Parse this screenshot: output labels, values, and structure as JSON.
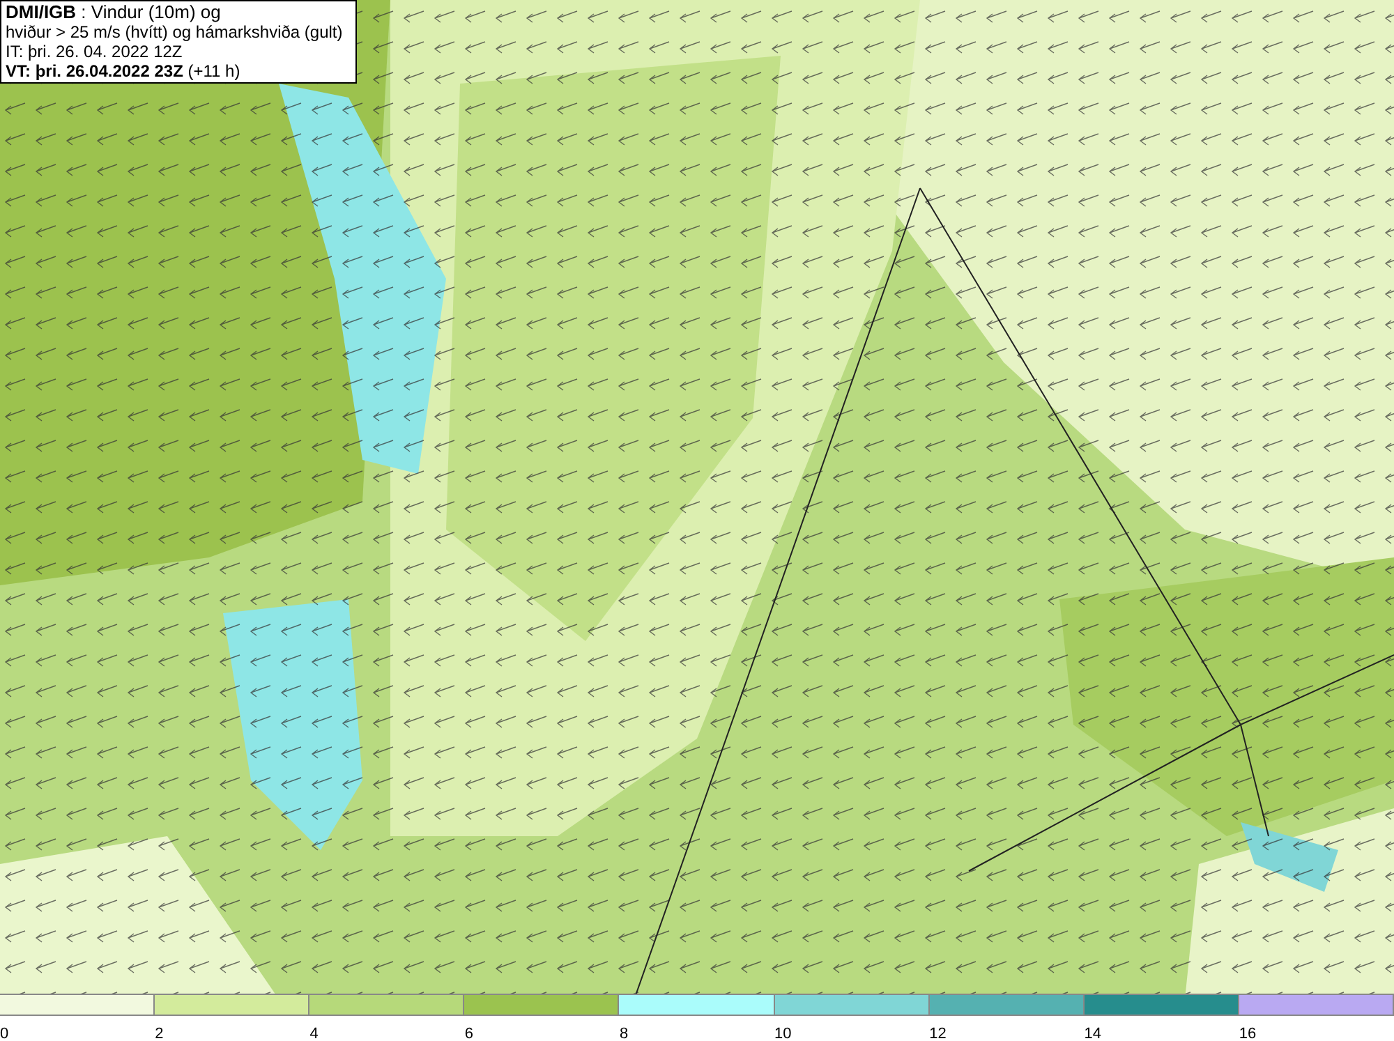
{
  "title_box": {
    "lines": [
      "**DMI/IGB** : Vindur (10m) og",
      "hviður > 25 m/s (hvítt) og hámarkshviða (gult)",
      "IT: þri. 26. 04. 2022 12Z",
      "**VT: þri. 26.04.2022 23Z** (+11 h)"
    ]
  },
  "legend": {
    "bins": [
      {
        "color": "#f2f9df",
        "tick": "0"
      },
      {
        "color": "#d3eb9c",
        "tick": "2"
      },
      {
        "color": "#b6d97a",
        "tick": "4"
      },
      {
        "color": "#9bc34f",
        "tick": "6"
      },
      {
        "color": "#aafcfb",
        "tick": "8"
      },
      {
        "color": "#80d6d6",
        "tick": "10"
      },
      {
        "color": "#55b1b1",
        "tick": "12"
      },
      {
        "color": "#268d8d",
        "tick": "14"
      },
      {
        "color": "#b9a9f2",
        "tick": "16"
      }
    ]
  }
}
